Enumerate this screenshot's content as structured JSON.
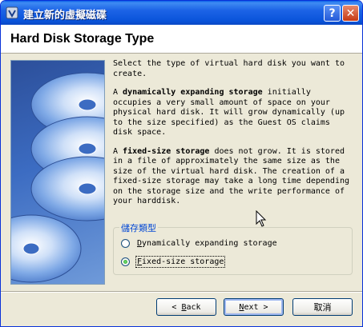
{
  "window": {
    "title": "建立新的虛擬磁碟",
    "help_label": "?",
    "close_label": "✕"
  },
  "header": {
    "title": "Hard Disk Storage Type"
  },
  "content": {
    "para1": "Select the type of virtual hard disk you want to create.",
    "para2_bold": "dynamically expanding storage",
    "para2_prefix": "A ",
    "para2_rest": " initially occupies a very small amount of space on your physical hard disk. It will grow dynamically (up to the size specified) as the Guest OS claims disk space.",
    "para3_prefix": "A ",
    "para3_bold": "fixed-size storage",
    "para3_rest": " does not grow. It is stored in a file of approximately the same size as the size of the virtual hard disk. The creation of a fixed-size storage may take a long time depending on the storage size and the write performance of your harddisk."
  },
  "storage_group": {
    "legend": "儲存類型",
    "options": [
      {
        "mnemonic": "D",
        "rest": "ynamically expanding storage",
        "selected": false
      },
      {
        "mnemonic": "F",
        "rest": "ixed-size storage",
        "selected": true
      }
    ]
  },
  "buttons": {
    "back_arrow": "<",
    "back_mnemonic": "B",
    "back_rest": "ack",
    "next_mnemonic": "N",
    "next_rest": "ext",
    "next_arrow": ">",
    "cancel": "取消"
  },
  "colors": {
    "titlebar": "#0a5fe8",
    "legend": "#0046d5",
    "radio_checked": "#21a121"
  }
}
